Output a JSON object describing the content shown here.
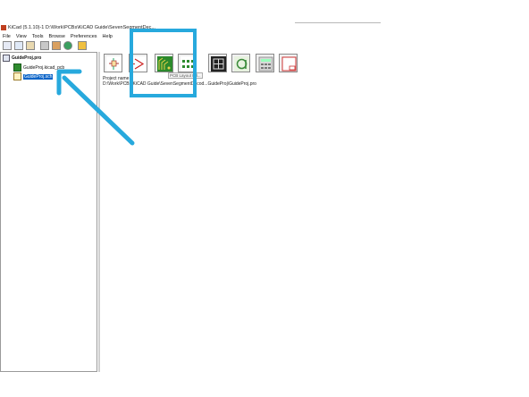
{
  "window": {
    "title": "KiCad (5.1.10)-1 D:\\Work\\PCBs\\KiCAD Guide\\SevenSegmentDec..."
  },
  "menu": [
    "File",
    "View",
    "Tools",
    "Browse",
    "Preferences",
    "Help"
  ],
  "tree": {
    "project": "GuideProj.pro",
    "pcb_file": "GuideProj.kicad_pcb",
    "sch_file": "GuideProj.sch"
  },
  "project_info": {
    "label": "Project name:",
    "path": "D:\\Work\\PCBs\\KiCAD Guide\\SevenSegmentDecod...GuideProj\\GuideProj.pro"
  },
  "tooltip": "PCB Layout Ed...",
  "colors": {
    "highlight": "#27a9dd",
    "selection": "#0a64c8"
  }
}
